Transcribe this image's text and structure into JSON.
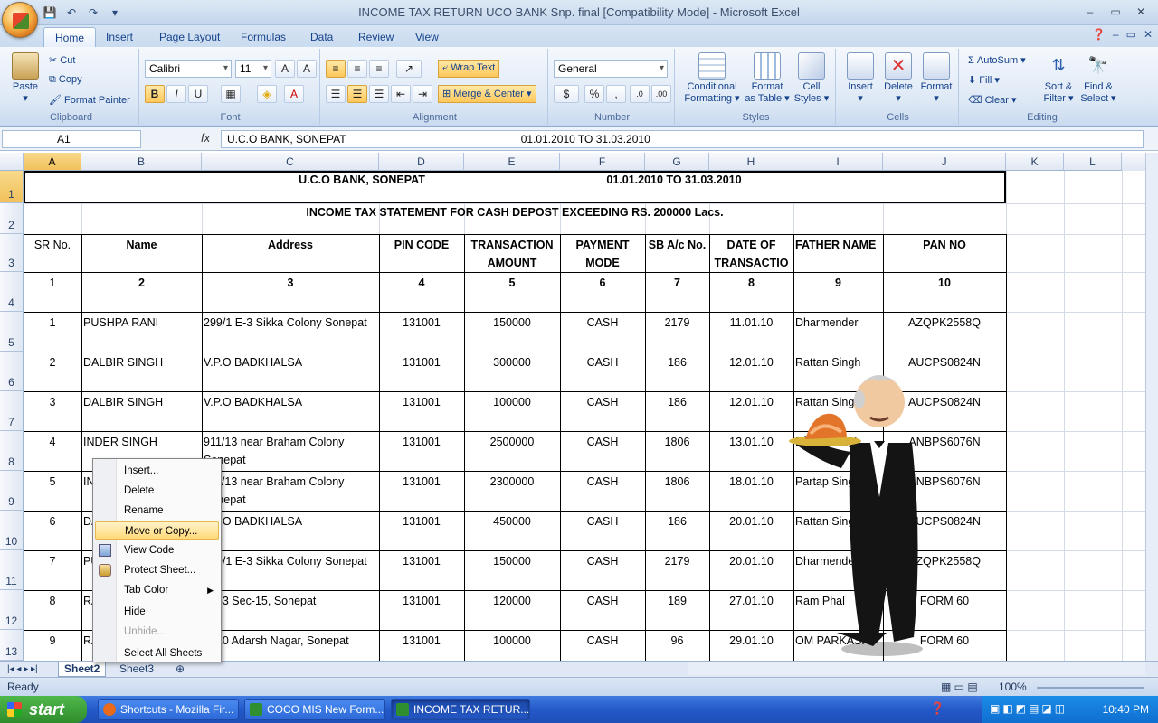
{
  "window": {
    "title": "INCOME TAX RETURN UCO  BANK Snp. final  [Compatibility Mode] - Microsoft Excel"
  },
  "tabs": [
    "Home",
    "Insert",
    "Page Layout",
    "Formulas",
    "Data",
    "Review",
    "View"
  ],
  "ribbon": {
    "clipboard": {
      "paste": "Paste",
      "cut": "Cut",
      "copy": "Copy",
      "format_painter": "Format Painter",
      "label": "Clipboard"
    },
    "font": {
      "name": "Calibri",
      "size": "11",
      "label": "Font"
    },
    "alignment": {
      "wrap": "Wrap Text",
      "merge": "Merge & Center",
      "label": "Alignment"
    },
    "number": {
      "format": "General",
      "label": "Number",
      "currency": "$",
      "percent": "%",
      "comma": ","
    },
    "styles": {
      "cond1": "Conditional",
      "cond2": "Formatting ▾",
      "fmt1": "Format",
      "fmt2": "as Table ▾",
      "cell1": "Cell",
      "cell2": "Styles ▾",
      "label": "Styles"
    },
    "cells": {
      "insert": "Insert",
      "delete": "Delete",
      "format": "Format",
      "label": "Cells"
    },
    "editing": {
      "autosum": "AutoSum ▾",
      "fill": "Fill ▾",
      "clear": "Clear ▾",
      "sort1": "Sort &",
      "sort2": "Filter ▾",
      "find1": "Find &",
      "find2": "Select ▾",
      "label": "Editing"
    }
  },
  "formula_bar": {
    "name_box": "A1",
    "fx": "fx",
    "value": "U.C.O BANK, SONEPAT                                                          01.01.2010 TO 31.03.2010"
  },
  "columns": [
    "A",
    "B",
    "C",
    "D",
    "E",
    "F",
    "G",
    "H",
    "I",
    "J",
    "K",
    "L"
  ],
  "rows": [
    "1",
    "2",
    "3",
    "4",
    "5",
    "6",
    "7",
    "8",
    "9",
    "10",
    "11",
    "12",
    "13"
  ],
  "sheet": {
    "title_left": "U.C.O BANK, SONEPAT",
    "title_right": "01.01.2010 TO 31.03.2010",
    "subtitle": "INCOME  TAX STATEMENT FOR CASH DEPOST EXCEEDING RS. 200000 Lacs.",
    "headers": [
      "SR No.",
      "Name",
      "Address",
      "PIN CODE",
      "TRANSACTION",
      "AMOUNT",
      "PAYMENT",
      "MODE",
      "SB A/c No.",
      "DATE OF",
      "TRANSACTIO",
      "FATHER NAME",
      "PAN NO"
    ],
    "numbers": [
      "1",
      "2",
      "3",
      "4",
      "5",
      "6",
      "7",
      "8",
      "9",
      "10"
    ],
    "data": [
      {
        "sr": "1",
        "name": "PUSHPA RANI",
        "addr": "299/1 E-3 Sikka Colony Sonepat",
        "addr2": "",
        "pin": "131001",
        "amt": "150000",
        "mode": "CASH",
        "sb": "2179",
        "date": "11.01.10",
        "father": "Dharmender",
        "pan": "AZQPK2558Q"
      },
      {
        "sr": "2",
        "name": "DALBIR SINGH",
        "addr": "V.P.O BADKHALSA",
        "addr2": "",
        "pin": "131001",
        "amt": "300000",
        "mode": "CASH",
        "sb": "186",
        "date": "12.01.10",
        "father": "Rattan Singh",
        "pan": "AUCPS0824N"
      },
      {
        "sr": "3",
        "name": "DALBIR SINGH",
        "addr": "V.P.O BADKHALSA",
        "addr2": "",
        "pin": "131001",
        "amt": "100000",
        "mode": "CASH",
        "sb": "186",
        "date": "12.01.10",
        "father": "Rattan Singh",
        "pan": "AUCPS0824N"
      },
      {
        "sr": "4",
        "name": "INDER SINGH",
        "addr": "911/13 near  Braham Colony",
        "addr2": "Sonepat",
        "pin": "131001",
        "amt": "2500000",
        "mode": "CASH",
        "sb": "1806",
        "date": "13.01.10",
        "father": "Partap Singh",
        "pan": "ANBPS6076N"
      },
      {
        "sr": "5",
        "name": "INDER SINGH",
        "addr": "911/13 near  Braham Colony",
        "addr2": "Sonepat",
        "pin": "131001",
        "amt": "2300000",
        "mode": "CASH",
        "sb": "1806",
        "date": "18.01.10",
        "father": "Partap Singh",
        "pan": "ANBPS6076N"
      },
      {
        "sr": "6",
        "name": "DALBIR SINGH",
        "addr": "V.P.O BADKHALSA",
        "addr2": "",
        "pin": "131001",
        "amt": "450000",
        "mode": "CASH",
        "sb": "186",
        "date": "20.01.10",
        "father": "Rattan Singh",
        "pan": "AUCPS0824N"
      },
      {
        "sr": "7",
        "name": "PUSHPA RANI",
        "addr": "299/1 E-3 Sikka Colony Sonepat",
        "addr2": "",
        "pin": "131001",
        "amt": "150000",
        "mode": "CASH",
        "sb": "2179",
        "date": "20.01.10",
        "father": "Dharmender",
        "pan": "AZQPK2558Q"
      },
      {
        "sr": "8",
        "name": "RAM",
        "addr": "1263 Sec-15, Sonepat",
        "addr2": "",
        "pin": "131001",
        "amt": "120000",
        "mode": "CASH",
        "sb": "189",
        "date": "27.01.10",
        "father": "Ram Phal",
        "pan": "FORM 60"
      },
      {
        "sr": "9",
        "name": "RAJ",
        "addr": "1410 Adarsh Nagar, Sonepat",
        "addr2": "",
        "pin": "131001",
        "amt": "100000",
        "mode": "CASH",
        "sb": "96",
        "date": "29.01.10",
        "father": "OM PARKASH",
        "pan": "FORM 60"
      }
    ]
  },
  "sheet_tabs": [
    "Sheet2",
    "Sheet3"
  ],
  "context_menu": [
    "Insert...",
    "Delete",
    "Rename",
    "Move or Copy...",
    "View Code",
    "Protect Sheet...",
    "Tab Color",
    "Hide",
    "Unhide...",
    "Select All Sheets"
  ],
  "status": {
    "ready": "Ready",
    "zoom": "100%"
  },
  "taskbar": {
    "start": "start",
    "tasks": [
      "Shortcuts - Mozilla Fir...",
      "COCO MIS New Form...",
      "INCOME TAX RETUR..."
    ],
    "clock": "10:40 PM"
  }
}
